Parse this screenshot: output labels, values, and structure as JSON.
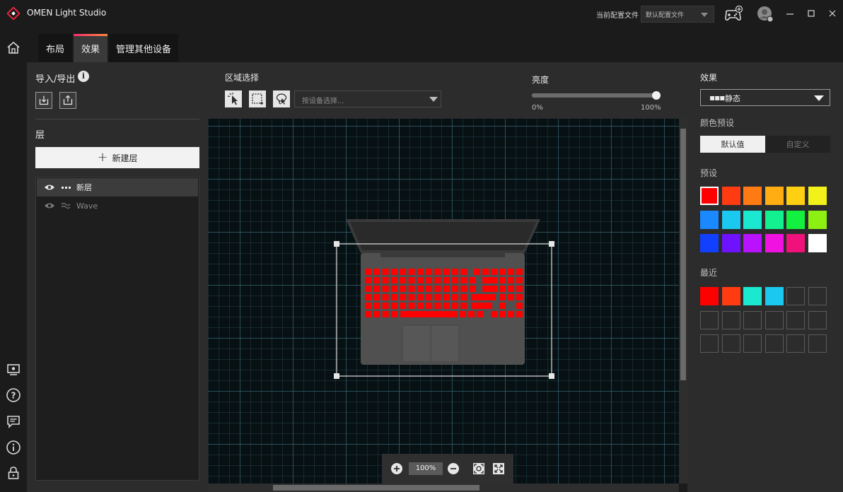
{
  "app": {
    "title": "OMEN Light Studio",
    "config_label": "当前配置文件",
    "config_value": "默认配置文件"
  },
  "tabs": [
    {
      "label": "布局"
    },
    {
      "label": "效果"
    },
    {
      "label": "管理其他设备"
    }
  ],
  "left_panel": {
    "import_export_label": "导入/导出",
    "layers_label": "层",
    "new_layer_label": "新建层",
    "layers": [
      {
        "name": "新层",
        "type_icon": "dots-icon",
        "selected": true
      },
      {
        "name": "Wave",
        "type_icon": "wave-icon",
        "selected": false
      }
    ]
  },
  "center": {
    "region_label": "区域选择",
    "device_placeholder": "按设备选择...",
    "brightness_label": "亮度",
    "brightness_value": 1.0,
    "brightness_min": "0%",
    "brightness_max": "100%",
    "zoom_value": "100%"
  },
  "right_panel": {
    "effect_label": "效果",
    "effect_value": "静态",
    "color_preset_label": "颜色预设",
    "preset_tabs": [
      "默认值",
      "自定义"
    ],
    "presets_label": "预设",
    "recent_label": "最近",
    "preset_colors": [
      "#ff0000",
      "#ff3b12",
      "#ff7a12",
      "#ffad12",
      "#ffd012",
      "#f2f21a",
      "#1a88ff",
      "#1ac8f0",
      "#1ae8d0",
      "#12f090",
      "#12f040",
      "#8cf012",
      "#1240ff",
      "#6e12ff",
      "#b812ff",
      "#f012e0",
      "#f0127a",
      "#ffffff"
    ],
    "selected_preset_index": 0,
    "recent_colors": [
      "#ff0000",
      "#ff3b12",
      "#1ae8d0",
      "#1ac8f0",
      "",
      "",
      "",
      "",
      "",
      "",
      "",
      "",
      "",
      "",
      "",
      "",
      "",
      ""
    ]
  },
  "colors": {
    "accent_gradient_start": "#ff2a6d",
    "accent_gradient_end": "#ff8a3d",
    "key_light": "#ff0000"
  }
}
